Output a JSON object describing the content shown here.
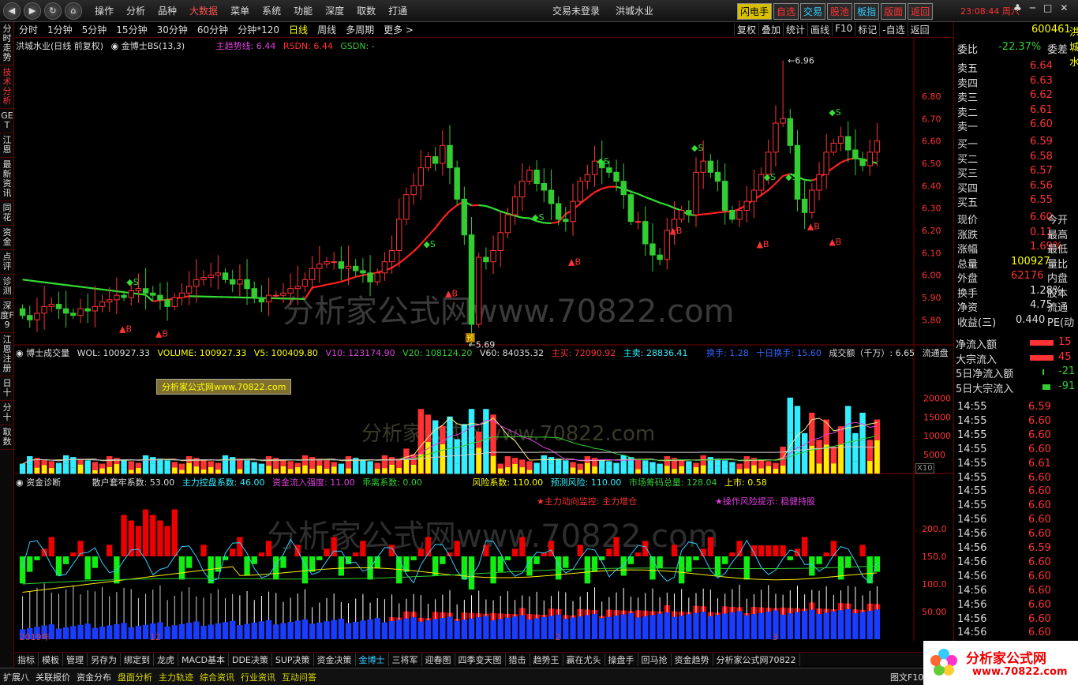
{
  "menu": {
    "items": [
      "操作",
      "分析",
      "品种",
      "大数据",
      "菜单",
      "系统",
      "功能",
      "深度",
      "取数",
      "打通"
    ],
    "login_status": "交易未登录",
    "stock_name": "洪城水业",
    "quick": [
      "闪电手",
      "自选",
      "交易",
      "股池",
      "板指",
      "版面",
      "返回"
    ],
    "clock": "23:08:44",
    "weekday": "周六"
  },
  "leftnav": [
    "分时走势",
    "技术分析",
    "GET",
    "江恩",
    "最新资讯",
    "同花",
    "资金",
    "点评",
    "诊测",
    "深度F9",
    "江恩注册",
    "日十",
    "分十",
    "取数"
  ],
  "periods": [
    "分时",
    "1分钟",
    "5分钟",
    "15分钟",
    "30分钟",
    "60分钟",
    "分钟*120",
    "日线",
    "周线",
    "多周期",
    "更多 >"
  ],
  "chart_tools": [
    "复权",
    "叠加",
    "统计",
    "画线",
    "F10",
    "标记",
    "-自选",
    "返回"
  ],
  "main_pane": {
    "title": "洪城水业(日线 前复权)",
    "indicator": "金博士BS(13,3)",
    "main_trend": "主趋势线: 6.44",
    "rsdn": "RSDN: 6.44",
    "gsdn": "GSDN: -",
    "high_mark": "6.96",
    "low_mark": "5.69",
    "watermark": "分析家公式网www.70822.com",
    "yu": "预",
    "b_label": "B",
    "s_label": "S"
  },
  "vol_pane": {
    "title": "博士成交量",
    "wol": "WOL: 100927.33",
    "volume": "VOLUME: 100927.33",
    "v5": "V5: 100409.80",
    "v10": "V10: 123174.90",
    "v20": "V20: 108124.20",
    "v60": "V60: 84035.32",
    "zhumai": "主买: 72090.92",
    "zhumai2": "主卖: 28836.41",
    "huanshou": "换手: 1.28",
    "shiri": "十日换手: 15.60",
    "chengjiao": "成交额（千万）: 6.65",
    "liutong": "流通盘",
    "banner": "分析家公式网www.70822.com",
    "x10": "X10",
    "watermark": "分析家公式网www.70822.com"
  },
  "fund_pane": {
    "title": "资金诊断",
    "sanhu": "散户套牢系数: 53.00",
    "zhuli": "主力控盘系数: 46.00",
    "zijin": "资金流入强度: 11.00",
    "guli": "乖离系数: 0.00",
    "fengxian": "风险系数: 110.00",
    "yuce": "预测风险: 110.00",
    "choumazl": "市场筹码总量: 128.04",
    "shangshi": "上市: 0.58",
    "monitor": "★主力动向监控: 主力增仓",
    "risk": "★操作风险提示: 稳健持股",
    "watermark": "分析家公式网www.70822.com"
  },
  "axes": {
    "price_ticks": [
      "6.80",
      "6.70",
      "6.60",
      "6.50",
      "6.40",
      "6.30",
      "6.20",
      "6.10",
      "6.00",
      "5.90",
      "5.80"
    ],
    "vol_ticks": [
      "20000",
      "15000",
      "10000",
      "5000"
    ],
    "fund_ticks": [
      "200.0",
      "150.0",
      "100.0",
      "50.00"
    ],
    "dates": [
      "2019年",
      "12",
      "2",
      "3"
    ]
  },
  "quotes": {
    "code": "600461",
    "name": "洪城水",
    "weibi_label": "委比",
    "weibi_value": "-22.37%",
    "weicha": "委差",
    "asks": [
      {
        "label": "卖五",
        "price": "6.64"
      },
      {
        "label": "卖四",
        "price": "6.63"
      },
      {
        "label": "卖三",
        "price": "6.62"
      },
      {
        "label": "卖二",
        "price": "6.61"
      },
      {
        "label": "卖一",
        "price": "6.60"
      }
    ],
    "bids": [
      {
        "label": "买一",
        "price": "6.59"
      },
      {
        "label": "买二",
        "price": "6.58"
      },
      {
        "label": "买三",
        "price": "6.57"
      },
      {
        "label": "买四",
        "price": "6.56"
      },
      {
        "label": "买五",
        "price": "6.55"
      }
    ],
    "stats": [
      {
        "label": "现价",
        "value": "6.60",
        "r": "今开"
      },
      {
        "label": "涨跌",
        "value": "0.11",
        "r": "最高"
      },
      {
        "label": "涨幅",
        "value": "1.69%",
        "r": "最低"
      },
      {
        "label": "总量",
        "value": "100927",
        "r": "量比"
      },
      {
        "label": "外盘",
        "value": "62176",
        "r": "内盘"
      },
      {
        "label": "换手",
        "value": "1.28%",
        "r": "股本"
      },
      {
        "label": "净资",
        "value": "4.75",
        "r": "流通"
      },
      {
        "label": "收益(三)",
        "value": "0.440",
        "r": "PE(动"
      }
    ],
    "flows": [
      {
        "label": "净流入额",
        "value": "15"
      },
      {
        "label": "大宗流入",
        "value": "45"
      },
      {
        "label": "5日净流入额",
        "value": "-21"
      },
      {
        "label": "5日大宗流入",
        "value": "-91"
      }
    ]
  },
  "trades": [
    {
      "t": "14:55",
      "p": "6.59"
    },
    {
      "t": "14:55",
      "p": "6.60"
    },
    {
      "t": "14:55",
      "p": "6.60"
    },
    {
      "t": "14:55",
      "p": "6.60"
    },
    {
      "t": "14:55",
      "p": "6.61"
    },
    {
      "t": "14:55",
      "p": "6.60"
    },
    {
      "t": "14:55",
      "p": "6.60"
    },
    {
      "t": "14:55",
      "p": "6.60"
    },
    {
      "t": "14:56",
      "p": "6.60"
    },
    {
      "t": "14:56",
      "p": "6.60"
    },
    {
      "t": "14:56",
      "p": "6.59"
    },
    {
      "t": "14:56",
      "p": "6.60"
    },
    {
      "t": "14:56",
      "p": "6.60"
    },
    {
      "t": "14:56",
      "p": "6.60"
    },
    {
      "t": "14:56",
      "p": "6.60"
    },
    {
      "t": "14:56",
      "p": "6.60"
    },
    {
      "t": "14:56",
      "p": "6.60"
    }
  ],
  "bottom_tabs": [
    "指标",
    "模板",
    "管理",
    "另存为",
    "绑定到",
    "龙虎",
    "MACD基本",
    "DDE决策",
    "SUP决策",
    "资金决策",
    "金博士",
    "三将军",
    "迎春图",
    "四季变天图",
    "猎击",
    "趋势王",
    "赢在尤头",
    "操盘手",
    "回马抢",
    "资金趋势",
    "分析家公式网70822"
  ],
  "status": [
    "扩展八",
    "关联报价",
    "资金分布",
    "盘面分析",
    "主力轨迹",
    "综合资讯",
    "行业资讯",
    "互动问答"
  ],
  "status_right": "图文F10",
  "logo": {
    "text": "分析家公式网",
    "url": "www.70822.com"
  },
  "colors": {
    "up": "#ff3333",
    "down": "#33cc33",
    "trend_up": "#ff2020",
    "trend_down": "#33dd33",
    "cyan": "#33eeff",
    "yellow": "#ffee00",
    "blue": "#1a3cff"
  },
  "chart_data": {
    "type": "candlestick",
    "open": [
      5.85,
      5.82,
      5.8,
      5.83,
      5.86,
      5.87,
      5.85,
      5.83,
      5.82,
      5.85,
      5.84,
      5.86,
      5.88,
      5.89,
      5.91,
      5.9,
      5.93,
      5.94,
      5.92,
      5.91,
      5.89,
      5.86,
      5.9,
      5.92,
      5.95,
      5.98,
      5.99,
      6.0,
      6.01,
      5.98,
      5.96,
      5.98,
      5.94,
      5.9,
      5.88,
      5.91,
      5.91,
      5.92,
      5.94,
      5.95,
      5.98,
      6.03,
      6.05,
      6.06,
      6.06,
      6.03,
      6.04,
      6.02,
      6.01,
      5.97,
      6.01,
      6.06,
      6.11,
      6.25,
      6.36,
      6.4,
      6.48,
      6.53,
      6.5,
      6.58,
      6.48,
      6.34,
      6.18,
      5.78,
      6.08,
      6.06,
      6.11,
      6.19,
      6.27,
      6.35,
      6.42,
      6.47,
      6.41,
      6.38,
      6.32,
      6.25,
      6.24,
      6.33,
      6.42,
      6.45,
      6.51,
      6.48,
      6.46,
      6.42,
      6.36,
      6.24,
      6.24,
      6.14,
      6.09,
      6.07,
      6.2,
      6.25,
      6.29,
      6.27,
      6.46,
      6.51,
      6.46,
      6.42,
      6.29,
      6.25,
      6.29,
      6.33,
      6.38,
      6.45,
      6.55,
      6.68,
      6.7,
      6.58,
      6.34,
      6.28,
      6.38,
      6.45,
      6.55,
      6.59,
      6.62,
      6.56,
      6.52,
      6.49,
      6.55
    ],
    "close": [
      5.82,
      5.8,
      5.83,
      5.86,
      5.87,
      5.85,
      5.83,
      5.82,
      5.85,
      5.84,
      5.86,
      5.88,
      5.89,
      5.91,
      5.9,
      5.93,
      5.94,
      5.92,
      5.91,
      5.89,
      5.86,
      5.9,
      5.92,
      5.95,
      5.98,
      5.99,
      6.0,
      6.01,
      5.98,
      5.96,
      5.98,
      5.94,
      5.9,
      5.88,
      5.91,
      5.91,
      5.92,
      5.94,
      5.95,
      5.98,
      6.03,
      6.05,
      6.06,
      6.06,
      6.03,
      6.04,
      6.02,
      6.01,
      5.97,
      6.01,
      6.06,
      6.11,
      6.25,
      6.36,
      6.4,
      6.48,
      6.53,
      6.5,
      6.58,
      6.48,
      6.34,
      6.18,
      5.78,
      6.08,
      6.06,
      6.11,
      6.19,
      6.27,
      6.35,
      6.42,
      6.47,
      6.41,
      6.38,
      6.32,
      6.25,
      6.24,
      6.33,
      6.42,
      6.45,
      6.51,
      6.48,
      6.46,
      6.42,
      6.36,
      6.24,
      6.24,
      6.14,
      6.09,
      6.07,
      6.2,
      6.25,
      6.29,
      6.27,
      6.46,
      6.51,
      6.46,
      6.42,
      6.29,
      6.25,
      6.29,
      6.33,
      6.38,
      6.45,
      6.55,
      6.68,
      6.7,
      6.58,
      6.34,
      6.28,
      6.38,
      6.45,
      6.55,
      6.59,
      6.62,
      6.56,
      6.52,
      6.49,
      6.55,
      6.6
    ],
    "ylim": [
      5.72,
      6.98
    ]
  }
}
